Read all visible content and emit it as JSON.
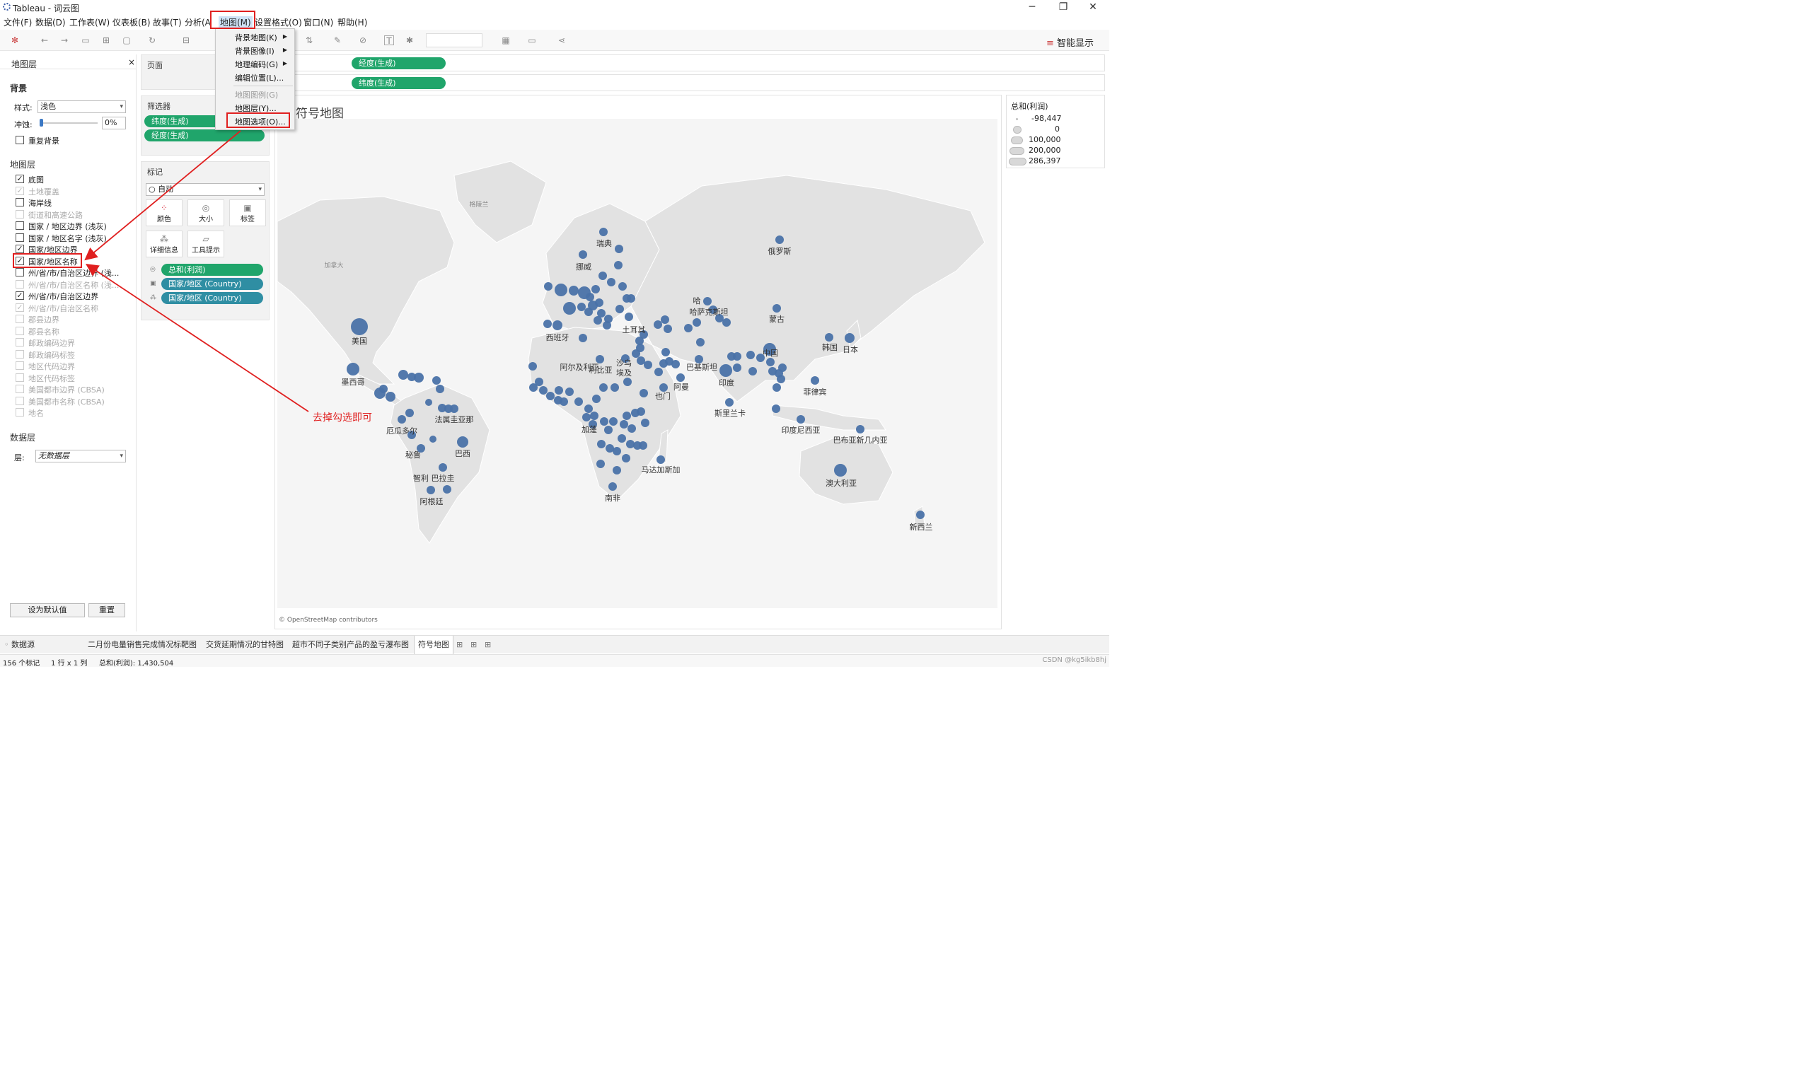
{
  "window": {
    "title": "Tableau - 词云图",
    "minimize": "─",
    "maximize": "❐",
    "close": "✕"
  },
  "menubar": {
    "items": [
      "文件(F)",
      "数据(D)",
      "工作表(W)",
      "仪表板(B)",
      "故事(T)",
      "分析(A",
      "地图(M)",
      "设置格式(O)",
      "窗口(N)",
      "帮助(H)"
    ]
  },
  "toolbar": {
    "smart_display": "智能显示"
  },
  "map_menu": {
    "items": [
      {
        "label": "背景地图(K)",
        "submenu": true,
        "disabled": false
      },
      {
        "label": "背景图像(I)",
        "submenu": true,
        "disabled": false
      },
      {
        "label": "地理编码(G)",
        "submenu": true,
        "disabled": false
      },
      {
        "label": "编辑位置(L)...",
        "submenu": false,
        "disabled": false
      },
      {
        "label": "地图图例(G)",
        "submenu": false,
        "disabled": true
      },
      {
        "label": "地图层(Y)...",
        "submenu": false,
        "disabled": false
      },
      {
        "label": "地图选项(O)...",
        "submenu": false,
        "disabled": false
      }
    ]
  },
  "map_layers_panel": {
    "title": "地图层",
    "close": "×",
    "background_heading": "背景",
    "style_label": "样式:",
    "style_value": "浅色",
    "wash_label": "冲蚀:",
    "wash_value": "0%",
    "wash_fraction": 0.0,
    "repeat_background": "重复背景",
    "layers_heading": "地图层",
    "layers": [
      {
        "label": "底图",
        "checked": true,
        "disabled": false
      },
      {
        "label": "土地覆盖",
        "checked": true,
        "disabled": true
      },
      {
        "label": "海岸线",
        "checked": false,
        "disabled": false
      },
      {
        "label": "街道和高速公路",
        "checked": false,
        "disabled": true
      },
      {
        "label": "国家 / 地区边界 (浅灰)",
        "checked": false,
        "disabled": false
      },
      {
        "label": "国家 / 地区名字 (浅灰)",
        "checked": false,
        "disabled": false
      },
      {
        "label": "国家/地区边界",
        "checked": true,
        "disabled": false
      },
      {
        "label": "国家/地区名称",
        "checked": true,
        "disabled": false
      },
      {
        "label": "州/省/市/自治区边界 (浅...",
        "checked": false,
        "disabled": false
      },
      {
        "label": "州/省/市/自治区名称 (浅...",
        "checked": false,
        "disabled": true
      },
      {
        "label": "州/省/市/自治区边界",
        "checked": true,
        "disabled": false
      },
      {
        "label": "州/省/市/自治区名称",
        "checked": true,
        "disabled": true
      },
      {
        "label": "郡县边界",
        "checked": false,
        "disabled": true
      },
      {
        "label": "郡县名称",
        "checked": false,
        "disabled": true
      },
      {
        "label": "邮政编码边界",
        "checked": false,
        "disabled": true
      },
      {
        "label": "邮政编码标签",
        "checked": false,
        "disabled": true
      },
      {
        "label": "地区代码边界",
        "checked": false,
        "disabled": true
      },
      {
        "label": "地区代码标签",
        "checked": false,
        "disabled": true
      },
      {
        "label": "美国都市边界 (CBSA)",
        "checked": false,
        "disabled": true
      },
      {
        "label": "美国都市名称 (CBSA)",
        "checked": false,
        "disabled": true
      },
      {
        "label": "地名",
        "checked": false,
        "disabled": true
      }
    ],
    "data_layer_heading": "数据层",
    "data_layer_label": "层:",
    "data_layer_value": "无数据层",
    "set_default": "设为默认值",
    "reset": "重置"
  },
  "pages": {
    "label": "页面"
  },
  "filters": {
    "label": "筛选器",
    "pills": [
      "纬度(生成)",
      "经度(生成)"
    ]
  },
  "marks": {
    "label": "标记",
    "type": "自动",
    "buttons": [
      "颜色",
      "大小",
      "标签",
      "详细信息",
      "工具提示"
    ],
    "pills": [
      "总和(利润)",
      "国家/地区 (Country)",
      "国家/地区 (Country)"
    ]
  },
  "shelves": {
    "columns_pill": "经度(生成)",
    "rows_pill": "纬度(生成)"
  },
  "view": {
    "title": "符号地图",
    "credit": "© OpenStreetMap contributors"
  },
  "legend": {
    "title": "总和(利润)",
    "entries": [
      "-98,447",
      "0",
      "100,000",
      "200,000",
      "286,397"
    ]
  },
  "map_labels": [
    "格陵兰",
    "加拿大",
    "美国",
    "墨西哥",
    "厄瓜多尔",
    "法属圭亚那",
    "秘鲁",
    "巴西",
    "智利",
    "巴拉圭",
    "阿根廷",
    "挪威",
    "瑞典",
    "西班牙",
    "阿尔及利亚",
    "利比亚",
    "埃及",
    "土耳其",
    "也门",
    "阿曼",
    "加蓬",
    "南非",
    "马达加斯加",
    "哈萨克斯坦",
    "巴基斯坦",
    "印度",
    "斯里兰卡",
    "中国",
    "蒙古",
    "韩国",
    "日本",
    "俄罗斯",
    "菲律宾",
    "印度尼西亚",
    "巴布亚新几内亚",
    "澳大利亚",
    "新西兰",
    "沙乌",
    "哈"
  ],
  "annotation": "去掉勾选即可",
  "tabs": {
    "datasource": "数据源",
    "sheets": [
      "二月份电量销售完成情况标靶图",
      "交货延期情况的甘特图",
      "超市不同子类别产品的盈亏瀑布图",
      "符号地图"
    ]
  },
  "status": {
    "marks": "156 个标记",
    "rows_cols": "1 行 x 1 列",
    "sum": "总和(利润): 1,430,504",
    "watermark": "CSDN @kg5ikb8hj"
  },
  "colors": {
    "accent_red": "#e02020",
    "mark_blue": "#4a72a8",
    "pill_green": "#20a56b",
    "pill_teal": "#2f8ea3",
    "land": "#e2e2e2",
    "water": "#f7f7f7"
  }
}
